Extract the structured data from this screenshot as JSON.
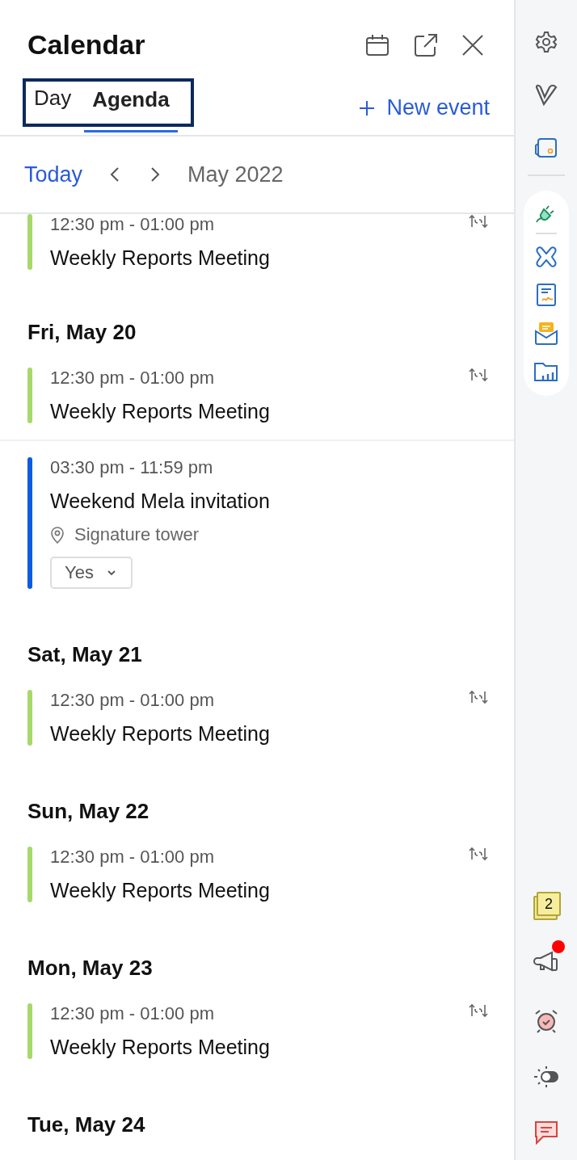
{
  "header": {
    "title": "Calendar"
  },
  "tabs": [
    {
      "label": "Day",
      "selected": false
    },
    {
      "label": "Agenda",
      "selected": true
    }
  ],
  "new_event_label": "New event",
  "navigation": {
    "today": "Today",
    "month": "May 2022"
  },
  "days": [
    {
      "events": [
        {
          "time": "12:30 pm - 01:00 pm",
          "title": "Weekly Reports Meeting",
          "color": "#a6d96a",
          "repeats": true
        }
      ]
    },
    {
      "label": "Fri, May 20",
      "events": [
        {
          "time": "12:30 pm - 01:00 pm",
          "title": "Weekly Reports Meeting",
          "color": "#a6d96a",
          "repeats": true
        },
        {
          "time": "03:30 pm - 11:59 pm",
          "title": "Weekend Mela invitation",
          "color": "#0b5ce0",
          "repeats": false,
          "location": "Signature tower",
          "rsvp": "Yes"
        }
      ]
    },
    {
      "label": "Sat, May 21",
      "events": [
        {
          "time": "12:30 pm - 01:00 pm",
          "title": "Weekly Reports Meeting",
          "color": "#a6d96a",
          "repeats": true
        }
      ]
    },
    {
      "label": "Sun, May 22",
      "events": [
        {
          "time": "12:30 pm - 01:00 pm",
          "title": "Weekly Reports Meeting",
          "color": "#a6d96a",
          "repeats": true
        }
      ]
    },
    {
      "label": "Mon, May 23",
      "events": [
        {
          "time": "12:30 pm - 01:00 pm",
          "title": "Weekly Reports Meeting",
          "color": "#a6d96a",
          "repeats": true
        }
      ]
    },
    {
      "label": "Tue, May 24"
    }
  ],
  "sidebar": {
    "notes_count": "2",
    "announcement_dot": true
  }
}
